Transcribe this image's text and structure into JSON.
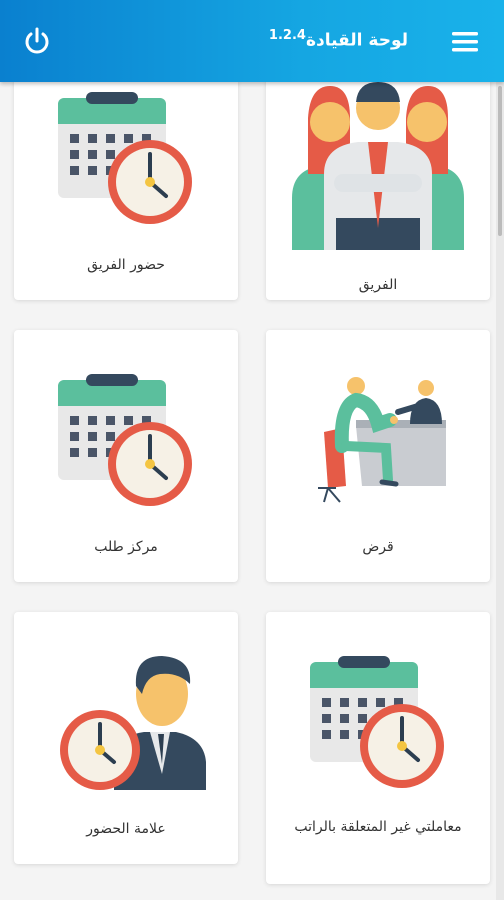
{
  "header": {
    "title": "لوحة القيادة",
    "version": "1.2.4",
    "menu_icon": "hamburger-menu-icon",
    "power_icon": "power-icon",
    "color": "#0f93d8"
  },
  "cards": [
    {
      "label": "الفريق",
      "icon": "team-icon"
    },
    {
      "label": "حضور الفريق",
      "icon": "calendar-clock-icon"
    },
    {
      "label": "قرض",
      "icon": "loan-meeting-icon"
    },
    {
      "label": "مركز طلب",
      "icon": "calendar-clock-icon"
    },
    {
      "label": "معاملتي غير المتعلقة بالراتب",
      "icon": "calendar-clock-icon"
    },
    {
      "label": "علامة الحضور",
      "icon": "attendance-person-clock-icon"
    }
  ]
}
